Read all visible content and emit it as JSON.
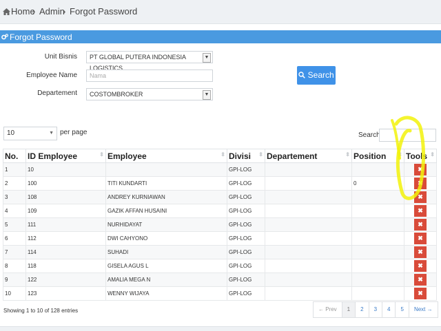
{
  "breadcrumb": {
    "home": "Home",
    "admin": "Admin",
    "current": "Forgot Password",
    "sep": "›"
  },
  "panel": {
    "title": "Forgot Password"
  },
  "form": {
    "unit_label": "Unit Bisnis",
    "unit_value": "PT GLOBAL PUTERA INDONESIA LOGISTICS",
    "employee_label": "Employee Name",
    "employee_placeholder": "Nama",
    "dept_label": "Departement",
    "dept_value": "COSTOMBROKER",
    "search_label": "Search"
  },
  "controls": {
    "page_size": "10",
    "per_page": "per page",
    "search_label": "Search:"
  },
  "table": {
    "headers": [
      "No.",
      "ID Employee",
      "Employee",
      "Divisi",
      "Departement",
      "Position",
      "Tools"
    ],
    "rows": [
      [
        "1",
        "10",
        "",
        "GPI-LOG",
        "",
        ""
      ],
      [
        "2",
        "100",
        "TITI KUNDARTI",
        "GPI-LOG",
        "",
        "0"
      ],
      [
        "3",
        "108",
        "ANDREY KURNIAWAN",
        "GPI-LOG",
        "",
        ""
      ],
      [
        "4",
        "109",
        "GAZIK AFFAN HUSAINI",
        "GPI-LOG",
        "",
        ""
      ],
      [
        "5",
        "111",
        "NURHIDAYAT",
        "GPI-LOG",
        "",
        ""
      ],
      [
        "6",
        "112",
        "DWI CAHYONO",
        "GPI-LOG",
        "",
        ""
      ],
      [
        "7",
        "114",
        "SUHADI",
        "GPI-LOG",
        "",
        ""
      ],
      [
        "8",
        "118",
        "GISELA AGUS L",
        "GPI-LOG",
        "",
        ""
      ],
      [
        "9",
        "122",
        "AMALIA MEGA N",
        "GPI-LOG",
        "",
        ""
      ],
      [
        "10",
        "123",
        "WENNY WIJAYA",
        "GPI-LOG",
        "",
        ""
      ]
    ],
    "delete_glyph": "✖"
  },
  "footer": {
    "info": "Showing 1 to 10 of 128 entries"
  },
  "pagination": {
    "prev": "← Prev",
    "pages": [
      "1",
      "2",
      "3",
      "4",
      "5"
    ],
    "next": "Next →"
  },
  "colors": {
    "header": "#4a9ae0",
    "button": "#3f92e8",
    "delete": "#d94b3a",
    "highlight": "#f2f20a"
  }
}
